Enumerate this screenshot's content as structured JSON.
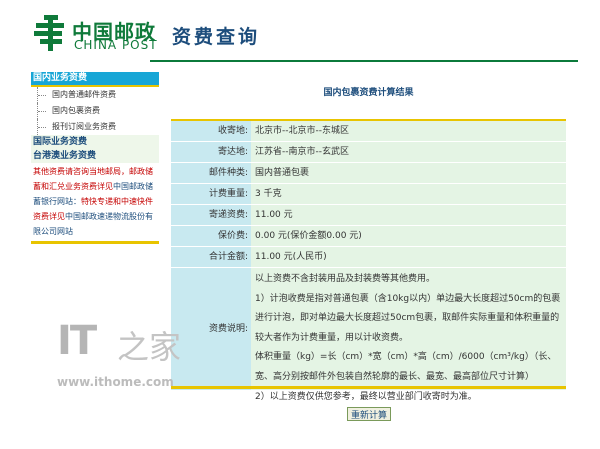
{
  "header": {
    "logo_cn": "中国邮政",
    "logo_en": "CHINA POST",
    "page_title": "资费查询"
  },
  "sidebar": {
    "domestic_head": "国内业务资费",
    "domestic_items": [
      "国内普通邮件资费",
      "国内包裹资费",
      "报刊订阅业务资费"
    ],
    "international": "国际业务资费",
    "hk_macau_tw": "台港澳业务资费",
    "note_red_1": "其他资费请咨询当地邮局，邮政储蓄和汇兑业务资费详见",
    "note_blue_1": "中国邮政储蓄银行网站：",
    "note_red_2": "特快专递和中速快件资费详见",
    "note_blue_2": "中国邮政速递物流股份有限公司网站"
  },
  "result": {
    "title": "国内包裹资费计算结果",
    "rows": [
      {
        "label": "收寄地:",
        "value": "北京市--北京市--东城区"
      },
      {
        "label": "寄达地:",
        "value": "江苏省--南京市--玄武区"
      },
      {
        "label": "邮件种类:",
        "value": "国内普通包裹"
      },
      {
        "label": "计费重量:",
        "value": "3 千克"
      },
      {
        "label": "寄递资费:",
        "value": "11.00 元"
      },
      {
        "label": "保价费:",
        "value": "0.00 元(保价金额0.00 元)"
      },
      {
        "label": "合计金额:",
        "value": "11.00 元(人民币)"
      }
    ],
    "notes_label": "资费说明:",
    "notes": [
      "以上资费不含封装用品及封装费等其他费用。",
      "1）计泡收费是指对普通包裹（含10kg以内）单边最大长度超过50cm的包裹",
      "进行计泡，即对单边最大长度超过50cm包裹，取邮件实际重量和体积重量的",
      "较大者作为计费重量，用以计收资费。",
      "体积重量（kg）=长（cm）*宽（cm）*高（cm）/6000（cm³/kg）（长、",
      "宽、高分别按邮件外包装自然轮廓的最长、最宽、最高部位尺寸计算）",
      "2）以上资费仅供您参考，最终以营业部门收寄时为准。"
    ],
    "recalc_button": "重新计算"
  },
  "watermark": {
    "brand": "IT",
    "brand_cn": "之家",
    "url": "www.ithome.com"
  },
  "colors": {
    "brand_green": "#0f7a3a",
    "nav_blue": "#17a6d6",
    "accent_yellow": "#e8c400",
    "label_bg": "#c8e9f0",
    "value_bg": "#e4f4e4"
  }
}
